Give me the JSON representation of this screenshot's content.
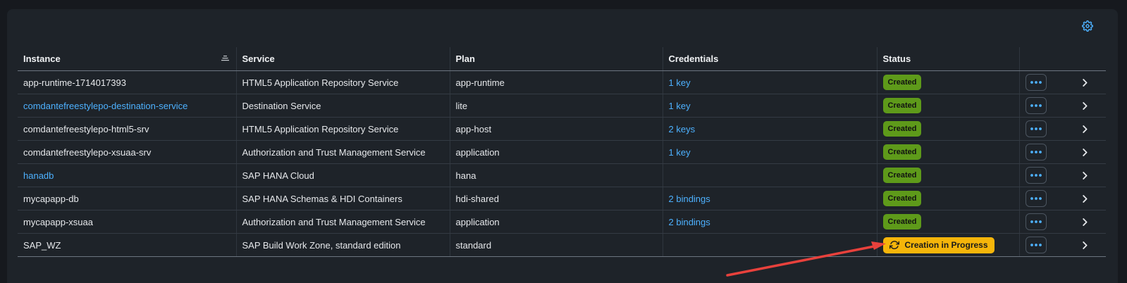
{
  "table": {
    "columns": {
      "instance": "Instance",
      "service": "Service",
      "plan": "Plan",
      "credentials": "Credentials",
      "status": "Status"
    },
    "rows": [
      {
        "instance": "app-runtime-1714017393",
        "instance_link": false,
        "service": "HTML5 Application Repository Service",
        "plan": "app-runtime",
        "credentials": "1 key",
        "status": "Created"
      },
      {
        "instance": "comdantefreestylepo-destination-service",
        "instance_link": true,
        "service": "Destination Service",
        "plan": "lite",
        "credentials": "1 key",
        "status": "Created"
      },
      {
        "instance": "comdantefreestylepo-html5-srv",
        "instance_link": false,
        "service": "HTML5 Application Repository Service",
        "plan": "app-host",
        "credentials": "2 keys",
        "status": "Created"
      },
      {
        "instance": "comdantefreestylepo-xsuaa-srv",
        "instance_link": false,
        "service": "Authorization and Trust Management Service",
        "plan": "application",
        "credentials": "1 key",
        "status": "Created"
      },
      {
        "instance": "hanadb",
        "instance_link": true,
        "service": "SAP HANA Cloud",
        "plan": "hana",
        "credentials": "",
        "status": "Created"
      },
      {
        "instance": "mycapapp-db",
        "instance_link": false,
        "service": "SAP HANA Schemas & HDI Containers",
        "plan": "hdi-shared",
        "credentials": "2 bindings",
        "status": "Created"
      },
      {
        "instance": "mycapapp-xsuaa",
        "instance_link": false,
        "service": "Authorization and Trust Management Service",
        "plan": "application",
        "credentials": "2 bindings",
        "status": "Created"
      },
      {
        "instance": "SAP_WZ",
        "instance_link": false,
        "service": "SAP Build Work Zone, standard edition",
        "plan": "standard",
        "credentials": "",
        "status": "Creation in Progress"
      }
    ]
  },
  "icons": {
    "settings": "gear-icon",
    "sort": "sort-icon",
    "more": "more-horizontal-icon",
    "row_nav": "chevron-right-icon",
    "in_progress": "refresh-icon"
  },
  "colors": {
    "background": "#16191e",
    "panel": "#1e2329",
    "link": "#4db1ff",
    "status_created": "#5e9a1a",
    "status_progress": "#f5b50a",
    "annotation_arrow": "#e8413c"
  }
}
